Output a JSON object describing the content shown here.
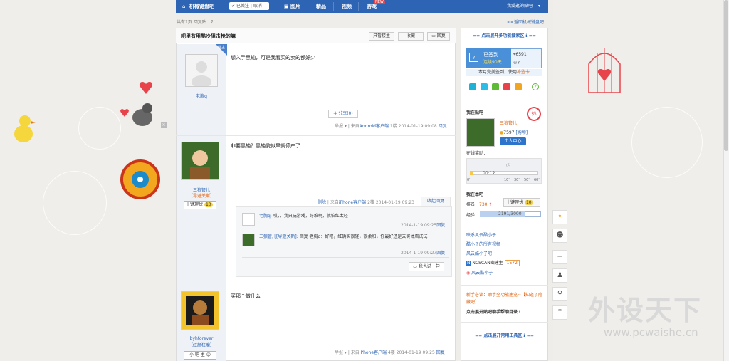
{
  "nav": {
    "forum_name": "机械键盘吧",
    "follow_state": "已关注",
    "unfollow": "取消",
    "tabs": [
      "图片",
      "精品",
      "视频",
      "游戏"
    ],
    "new_badge": "NEW",
    "my_forums": "我爱逛的贴吧"
  },
  "meta": {
    "page_info": "共有1页",
    "reply_count": "回复贴：7",
    "back_link": "<<返回机械键盘吧"
  },
  "thread": {
    "title": "吧里有用酷冷狙击枪的嘛",
    "only_op": "只看楼主",
    "favorite": "收藏",
    "reply": "回复"
  },
  "posts": [
    {
      "author": "老胸q",
      "content": "想入手黑轴，可是我看买的卖的都好少",
      "share": "分享(0)",
      "report": "举报",
      "source_prefix": "来自",
      "client": "Android客户端",
      "floor": "1楼",
      "time": "2014-01-19 09:08",
      "reply": "回复",
      "op_tag": "楼主"
    },
    {
      "author": "三狼管儿",
      "badge": "【导遊关斯】",
      "level_label": "十键理伏",
      "level": "10",
      "content": "非要黑轴？黑轴貌似早就停产了",
      "delete": "删除",
      "source_prefix": "来自",
      "client": "iPhone客户端",
      "floor": "2楼",
      "time": "2014-01-19 09:23",
      "collapse": "收起回复",
      "comments": [
        {
          "name": "老胸q:",
          "text": "哎，，我只玩游戏，好难啊，就怕红太轻",
          "time": "2014-1-19 09:25",
          "reply": "回复"
        },
        {
          "name": "三狼管儿[导遊关斯]:",
          "text": "回复 老胸q：好吧，红确实很轻，很柔和，你最好还是去实体店试试",
          "time": "2014-1-19 09:27",
          "reply": "回复"
        }
      ],
      "say_something": "我也说一句"
    },
    {
      "author": "byhforever",
      "badge": "【红颜狂魔】",
      "role": "小 吧 主",
      "content": "买那个做什么",
      "report": "举报",
      "source_prefix": "来自",
      "client": "iPhone客户端",
      "floor": "4楼",
      "time": "2014-01-19 09:25",
      "reply": "回复"
    }
  ],
  "sidebar": {
    "search_header": "点击展开多功能搜索区",
    "signed": "已签到",
    "streak": "连续90天",
    "rank": "6591",
    "count": "7",
    "sign_note": "本月完美签到，使用",
    "sign_card": "补签卡",
    "in_forum_title": "我在贴吧",
    "username": "三狼管儿",
    "points": "7597",
    "points_tag": "[购物]",
    "personal_center": "个人中心",
    "online_award": "在线奖励：",
    "timer": "00:12",
    "timer_ticks": [
      "0'",
      "10'",
      "30'",
      "50'",
      "60'"
    ],
    "in_this_forum": "我在本吧",
    "rank_label": "排名：",
    "rank_value": "730",
    "level_label": "十键理伏",
    "level": "10",
    "exp_label": "经验：",
    "exp_value": "2191/3000",
    "exp_fraction": 0.73,
    "links": [
      "联系风云酷小子",
      "酷小子的所有视频",
      "风云酷小子吧"
    ],
    "ncscan": "NCSCAN幽建生",
    "ncscan_val": "1572",
    "weibo": "风云酷小子",
    "newbie_note": "新手必读：助手全功能速览~【知道了隐藏吧】",
    "helper": "点击展开贴吧助手帮助目录",
    "tools_header": "点击展开常用工具区"
  },
  "watermark": {
    "title": "外设天下",
    "url": "www.pcwaishe.cn"
  },
  "colors": {
    "nav": "#2d64b3",
    "link": "#2d64b3",
    "accent": "#e05a00"
  }
}
